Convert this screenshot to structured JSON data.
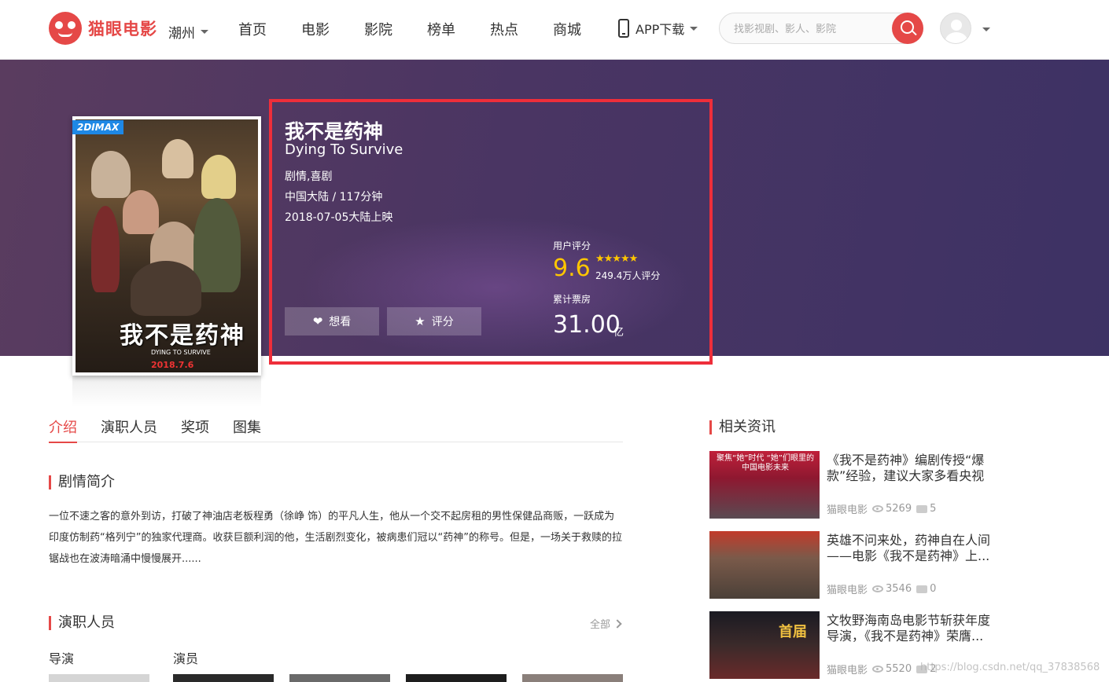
{
  "header": {
    "logo_text": "猫眼电影",
    "city": "潮州",
    "nav": [
      "首页",
      "电影",
      "影院",
      "榜单",
      "热点",
      "商城"
    ],
    "app_download": "APP下载",
    "search_placeholder": "找影视剧、影人、影院"
  },
  "movie": {
    "badge": "2DIMAX",
    "name": "我不是药神",
    "ename": "Dying To Survive",
    "genre": "剧情,喜剧",
    "region_duration": "中国大陆 / 117分钟",
    "release": "2018-07-05大陆上映",
    "poster_title": "我不是药神",
    "poster_subtitle": "DYING TO SURVIVE",
    "poster_date": "2018.7.6",
    "want_label": "想看",
    "rate_label": "评分",
    "rating_label": "用户评分",
    "rating_score": "9.6",
    "rating_stars": 5,
    "rating_count": "249.4万人评分",
    "box_office_label": "累计票房",
    "box_office_value": "31.00",
    "box_office_unit": "亿"
  },
  "tabs": [
    "介绍",
    "演职人员",
    "奖项",
    "图集"
  ],
  "synopsis": {
    "title": "剧情简介",
    "text": "一位不速之客的意外到访，打破了神油店老板程勇（徐峥 饰）的平凡人生，他从一个交不起房租的男性保健品商贩，一跃成为印度仿制药“格列宁”的独家代理商。收获巨额利润的他，生活剧烈变化，被病患们冠以“药神”的称号。但是，一场关于救赎的拉锯战也在波涛暗涌中慢慢展开......"
  },
  "cast": {
    "title": "演职人员",
    "all": "全部",
    "director_label": "导演",
    "actor_label": "演员"
  },
  "news": {
    "title": "相关资讯",
    "items": [
      {
        "title": "《我不是药神》编剧传授“爆款”经验，建议大家多看央视",
        "source": "猫眼电影",
        "views": "5269",
        "comments": "5",
        "img_text": "聚焦“她”时代  “她”们眼里的中国电影未来"
      },
      {
        "title": "英雄不问来处，药神自在人间——电影《我不是药神》上...",
        "source": "猫眼电影",
        "views": "3546",
        "comments": "0",
        "img_text": ""
      },
      {
        "title": "文牧野海南岛电影节斩获年度导演，《我不是药神》荣膺...",
        "source": "猫眼电影",
        "views": "5520",
        "comments": "2",
        "img_text": "首届"
      }
    ]
  },
  "watermark": "https://blog.csdn.net/qq_37838568"
}
